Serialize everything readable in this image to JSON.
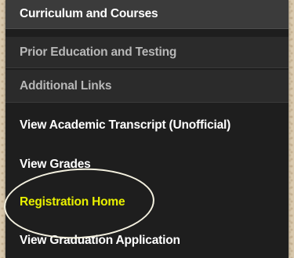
{
  "menu": {
    "sections": [
      {
        "label": "Curriculum and Courses"
      },
      {
        "label": "Prior Education and Testing"
      },
      {
        "label": "Additional Links"
      }
    ],
    "links": [
      {
        "label": "View Academic Transcript (Unofficial)"
      },
      {
        "label": "View Grades"
      },
      {
        "label": "Registration Home"
      },
      {
        "label": "View Graduation Application"
      }
    ]
  },
  "colors": {
    "highlight_text": "#e8f000",
    "annotation_circle": "#f4f1e0"
  }
}
